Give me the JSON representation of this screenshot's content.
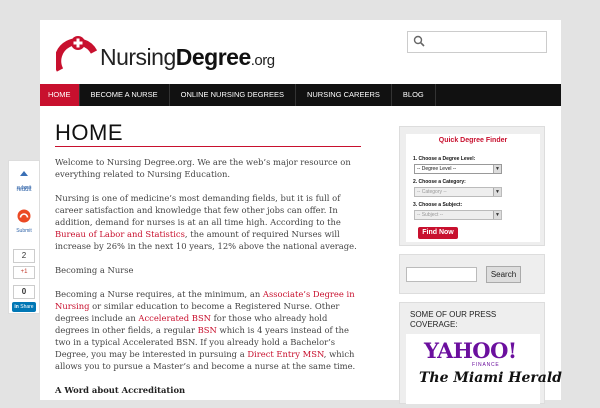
{
  "header": {
    "logo": {
      "name": "Nursing",
      "name_bold": "Degree",
      "tld": ".org"
    },
    "search_placeholder": ""
  },
  "nav": {
    "items": [
      {
        "label": "HOME",
        "active": true
      },
      {
        "label": "BECOME A NURSE",
        "active": false
      },
      {
        "label": "ONLINE NURSING DEGREES",
        "active": false
      },
      {
        "label": "NURSING CAREERS",
        "active": false
      },
      {
        "label": "BLOG",
        "active": false
      }
    ]
  },
  "main": {
    "title": "HOME",
    "p1": "Welcome to Nursing Degree.org. We are the web’s major resource on everything related to Nursing Education.",
    "p2_a": "Nursing is one of medicine’s most demanding fields, but it is full of career satisfaction and knowledge that few other jobs can offer. In addition, demand for nurses is at an all time high. According to the ",
    "p2_link": "Bureau of Labor and Statistics",
    "p2_b": ", the amount of required Nurses will increase by 26% in the next 10 years, 12% above the national average.",
    "p3": "Becoming a Nurse",
    "p4_a": "Becoming a Nurse requires, at the minimum, an ",
    "p4_link1": "Associate’s Degree in Nursing",
    "p4_b": " or similar education to become a Registered Nurse. Other degrees include an ",
    "p4_link2": "Accelerated BSN",
    "p4_c": " for those who already hold degrees in other fields, a regular ",
    "p4_link3": "BSN",
    "p4_d": " which is 4 years instead of the two in a typical Accelerated BSN. If you already hold a Bachelor’s Degree, you may be interested in pursuing a ",
    "p4_link4": "Direct Entry MSN",
    "p4_e": ", which allows you to pursue a Master’s and become a nurse at the same time.",
    "h_accreditation": "A Word about Accreditation"
  },
  "share": {
    "stumble_label": "submit",
    "reddit_label": "reddit",
    "submit_label": "Submit",
    "google_count": "2",
    "google_label": "+1",
    "linkedin_count": "0",
    "linkedin_label": "Share"
  },
  "sidebar": {
    "finder": {
      "title": "Quick Degree Finder",
      "label1": "1. Choose a Degree Level:",
      "select1": "-- Degree Level --",
      "label2": "2. Choose a Category:",
      "select2": "-- Category --",
      "label3": "3. Choose a Subject:",
      "select3": "-- Subject --",
      "button": "Find Now"
    },
    "search_button": "Search",
    "press": {
      "title": "SOME OF OUR PRESS COVERAGE:",
      "yahoo": "YAHOO!",
      "yahoo_sub": "FINANCE",
      "herald": "The Miami Herald"
    }
  },
  "colors": {
    "accent": "#c8102e",
    "nav_bg": "#111111",
    "page_bg": "#e3e3e3"
  }
}
